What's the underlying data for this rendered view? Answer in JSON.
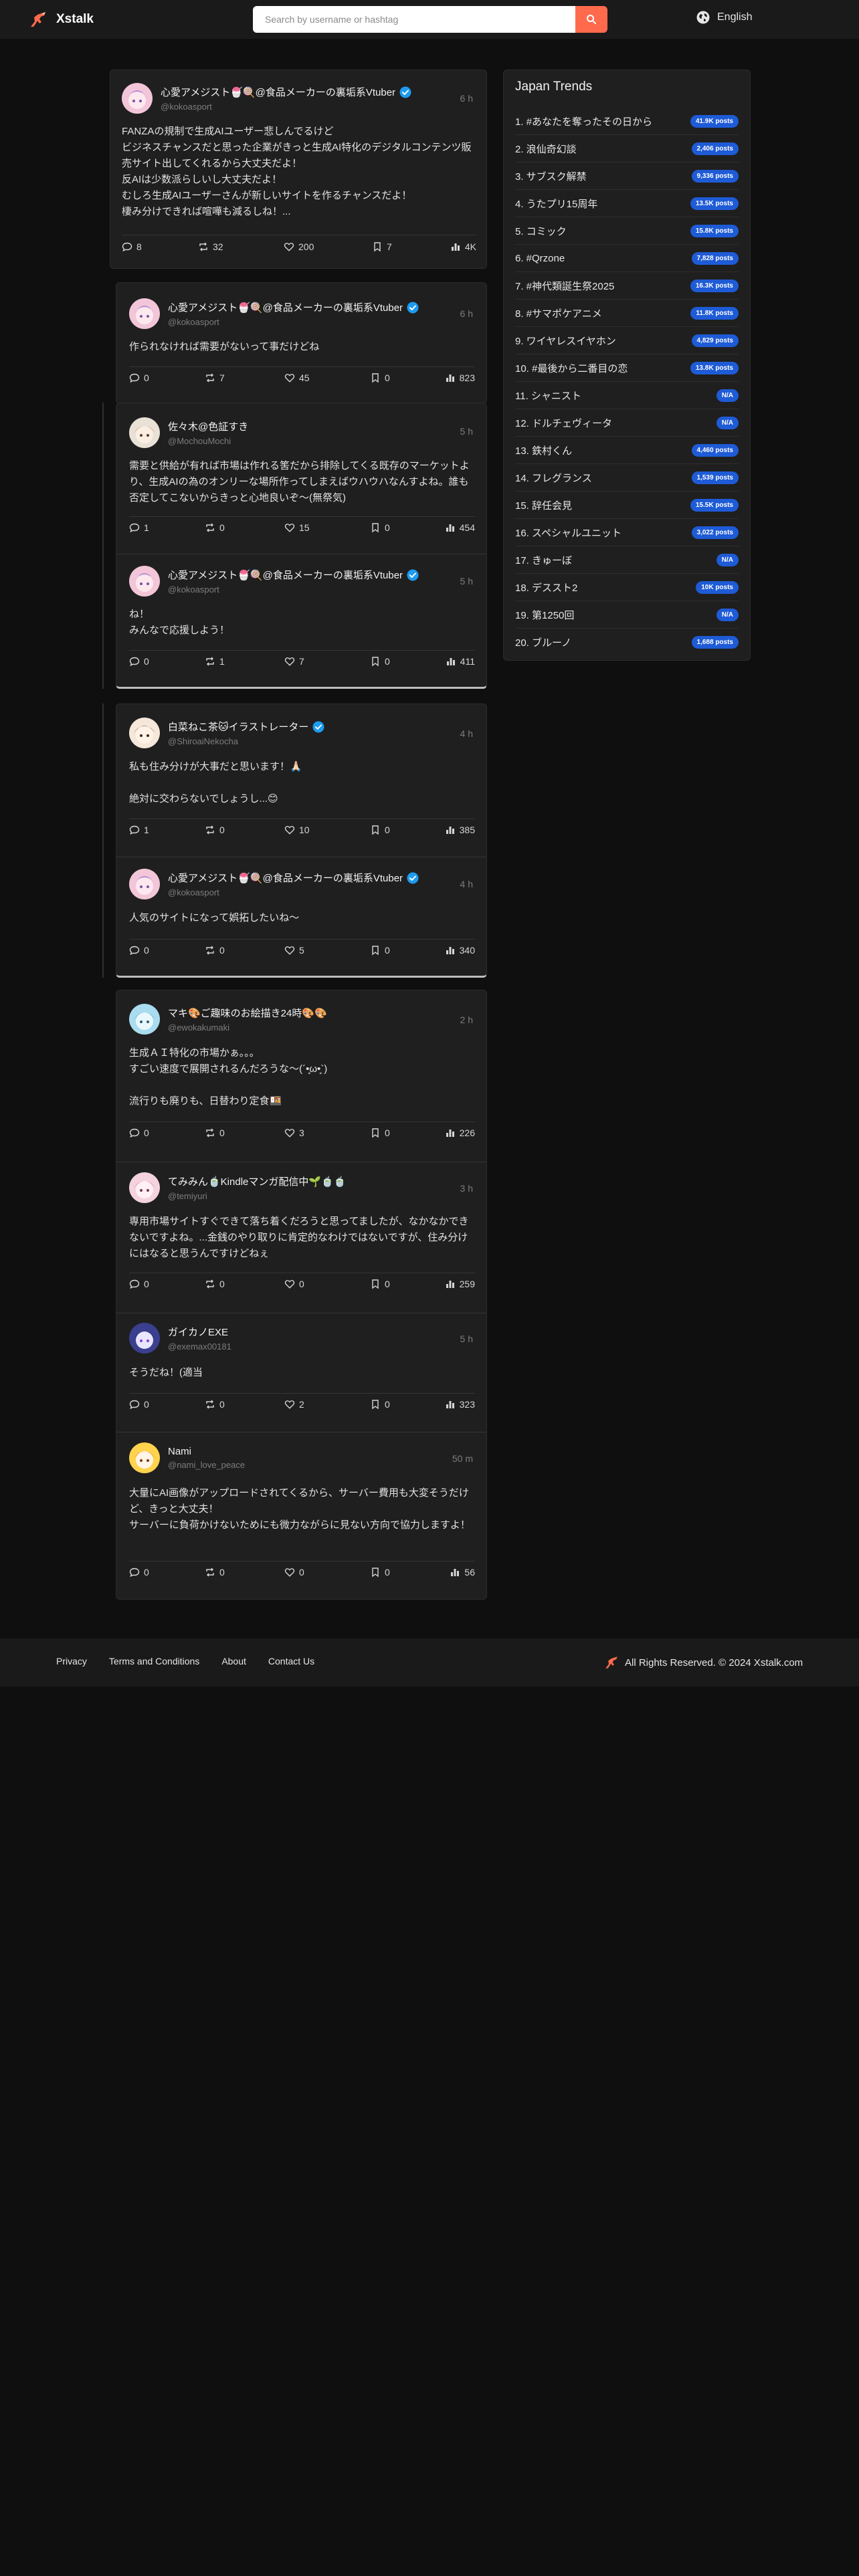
{
  "header": {
    "logo_text": "Xstalk",
    "search_placeholder": "Search by username or hashtag",
    "language": "English"
  },
  "colors": {
    "accent": "#ff6a4d",
    "verified": "#1d9bf0",
    "badge": "#1e5bd6",
    "background": "#0f0f0f",
    "card": "#1f1f1f"
  },
  "posts": {
    "main": {
      "name": "心愛アメジスト🍧🍭@食品メーカーの裏垢系Vtuber",
      "handle": "@kokoasport",
      "time": "6 h",
      "body": "FANZAの規制で生成AIユーザー悲しんでるけど\nビジネスチャンスだと思った企業がきっと生成AI特化のデジタルコンテンツ販売サイト出してくれるから大丈夫だよ！\n反AIは少数派らしいし大丈夫だよ！\nむしろ生成AIユーザーさんが新しいサイトを作るチャンスだよ！\n棲み分けできれば喧嘩も減るしね！...",
      "replies": "8",
      "reposts": "32",
      "likes": "200",
      "bookmarks": "7",
      "views": "4K"
    },
    "t1p1": {
      "name": "心愛アメジスト🍧🍭@食品メーカーの裏垢系Vtuber",
      "handle": "@kokoasport",
      "time": "6 h",
      "body": "作られなければ需要がないって事だけどね",
      "replies": "0",
      "reposts": "7",
      "likes": "45",
      "bookmarks": "0",
      "views": "823"
    },
    "t1p2": {
      "name": "佐々木@色証すき",
      "handle": "@MochouMochi",
      "time": "5 h",
      "body": "需要と供給が有れば市場は作れる筈だから排除してくる既存のマーケットより、生成AIの為のオンリーな場所作ってしまえばウハウハなんすよね。誰も否定してこないからきっと心地良いぞ〜(無祭気)",
      "replies": "1",
      "reposts": "0",
      "likes": "15",
      "bookmarks": "0",
      "views": "454"
    },
    "t1p3": {
      "name": "心愛アメジスト🍧🍭@食品メーカーの裏垢系Vtuber",
      "handle": "@kokoasport",
      "time": "5 h",
      "body": "ね！\nみんなで応援しよう！",
      "replies": "0",
      "reposts": "1",
      "likes": "7",
      "bookmarks": "0",
      "views": "411"
    },
    "t2p1": {
      "name": "白菜ねこ茶🐱イラストレーター",
      "handle": "@ShiroaiNekocha",
      "time": "4 h",
      "body": "私も住み分けが大事だと思います！🙏🏻\n\n絶対に交わらないでしょうし...😊",
      "replies": "1",
      "reposts": "0",
      "likes": "10",
      "bookmarks": "0",
      "views": "385"
    },
    "t2p2": {
      "name": "心愛アメジスト🍧🍭@食品メーカーの裏垢系Vtuber",
      "handle": "@kokoasport",
      "time": "4 h",
      "body": "人気のサイトになって娯拓したいね〜",
      "replies": "0",
      "reposts": "0",
      "likes": "5",
      "bookmarks": "0",
      "views": "340"
    },
    "s1": {
      "name": "マキ🎨ご趣味のお絵描き24時🎨🎨",
      "handle": "@ewokakumaki",
      "time": "2 h",
      "body": "生成ＡＩ特化の市場かぁ。。。\nすごい速度で展開されるんだろうな〜(´•̥ω•̥`)\n\n流行りも廃りも、日替わり定食🍱",
      "replies": "0",
      "reposts": "0",
      "likes": "3",
      "bookmarks": "0",
      "views": "226"
    },
    "s2": {
      "name": "てみみん🍵Kindleマンガ配信中🌱🍵🍵",
      "handle": "@temiyuri",
      "time": "3 h",
      "body": "専用市場サイトすぐできて落ち着くだろうと思ってましたが、なかなかできないですよね。...金銭のやり取りに肯定的なわけではないですが、住み分けにはなると思うんですけどねぇ",
      "replies": "0",
      "reposts": "0",
      "likes": "0",
      "bookmarks": "0",
      "views": "259"
    },
    "s3": {
      "name": "ガイカノEXE",
      "handle": "@exemax00181",
      "time": "5 h",
      "body": "そうだね！(適当",
      "replies": "0",
      "reposts": "0",
      "likes": "2",
      "bookmarks": "0",
      "views": "323"
    },
    "s4": {
      "name": "Nami",
      "handle": "@nami_love_peace",
      "time": "50 m",
      "body": "大量にAI画像がアップロードされてくるから、サーバー費用も大変そうだけど、きっと大丈夫！\nサーバーに負荷かけないためにも微力ながらに見ない方向で協力しますよ！",
      "replies": "0",
      "reposts": "0",
      "likes": "0",
      "bookmarks": "0",
      "views": "56"
    }
  },
  "trends": {
    "title": "Japan Trends",
    "items": [
      {
        "label": "1. #あなたを奪ったその日から",
        "count": "41.9K posts"
      },
      {
        "label": "2. 浪仙奇幻談",
        "count": "2,406 posts"
      },
      {
        "label": "3. サブスク解禁",
        "count": "9,336 posts"
      },
      {
        "label": "4. うたプリ15周年",
        "count": "13.5K posts"
      },
      {
        "label": "5. コミック",
        "count": "15.8K posts"
      },
      {
        "label": "6. #Qrzone",
        "count": "7,828 posts"
      },
      {
        "label": "7. #神代類誕生祭2025",
        "count": "16.3K posts"
      },
      {
        "label": "8. #サマポケアニメ",
        "count": "11.8K posts"
      },
      {
        "label": "9. ワイヤレスイヤホン",
        "count": "4,829 posts"
      },
      {
        "label": "10. #最後から二番目の恋",
        "count": "13.8K posts"
      },
      {
        "label": "11. シャニスト",
        "count": "N/A"
      },
      {
        "label": "12. ドルチェヴィータ",
        "count": "N/A"
      },
      {
        "label": "13. 鉄村くん",
        "count": "4,460 posts"
      },
      {
        "label": "14. フレグランス",
        "count": "1,539 posts"
      },
      {
        "label": "15. 辞任会見",
        "count": "15.5K posts"
      },
      {
        "label": "16. スペシャルユニット",
        "count": "3,022 posts"
      },
      {
        "label": "17. きゅーぼ",
        "count": "N/A"
      },
      {
        "label": "18. デススト2",
        "count": "10K posts"
      },
      {
        "label": "19. 第1250回",
        "count": "N/A"
      },
      {
        "label": "20. ブルーノ",
        "count": "1,688 posts"
      }
    ]
  },
  "footer": {
    "links": [
      "Privacy",
      "Terms and Conditions",
      "About",
      "Contact Us"
    ],
    "copyright": "All Rights Reserved. © 2024 Xstalk.com"
  }
}
